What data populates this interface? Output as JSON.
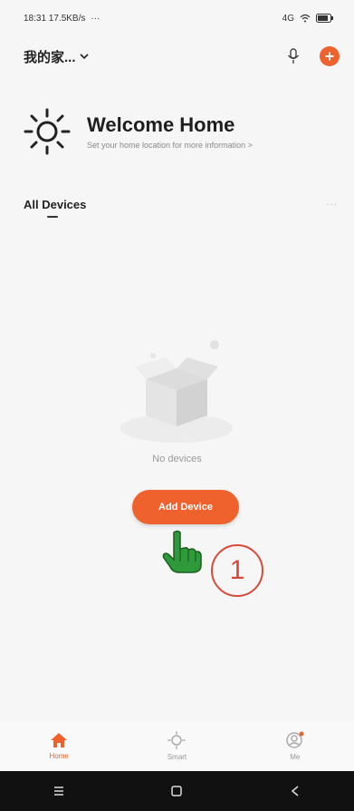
{
  "status_bar": {
    "left_text": "18:31 17.5KB/s",
    "right_text": "4G"
  },
  "header": {
    "home_name": "我的家...",
    "mic_icon": "mic-icon",
    "add_icon": "plus-icon"
  },
  "welcome": {
    "title": "Welcome Home",
    "subtitle": "Set your home location for more information >"
  },
  "section": {
    "label": "All Devices",
    "more": "···"
  },
  "empty_state": {
    "text": "No devices",
    "button": "Add Device"
  },
  "annotation": {
    "step": "1"
  },
  "tabbar": {
    "tabs": [
      {
        "label": "Home",
        "icon": "home-icon",
        "active": true
      },
      {
        "label": "Smart",
        "icon": "smart-icon",
        "active": false
      },
      {
        "label": "Me",
        "icon": "profile-icon",
        "active": false
      }
    ]
  },
  "colors": {
    "accent": "#f0622d",
    "annotation": "#d64a3a"
  }
}
